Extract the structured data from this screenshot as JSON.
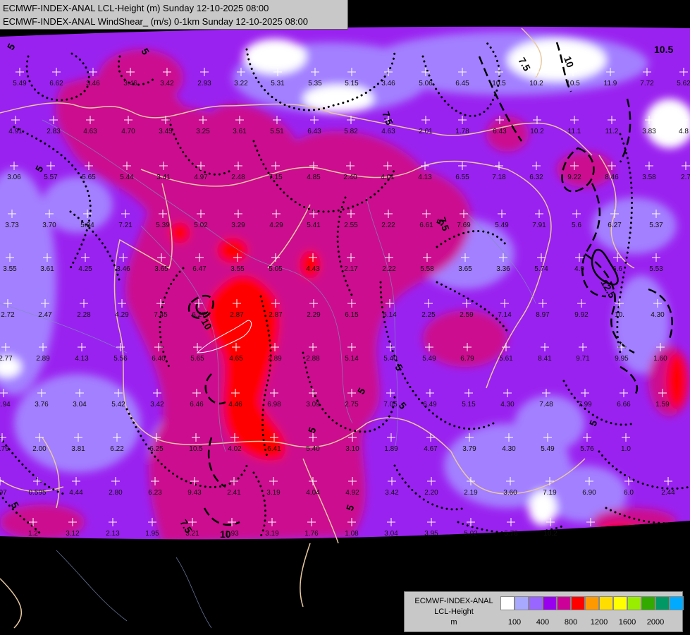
{
  "header": {
    "line1": "ECMWF-INDEX-ANAL LCL-Height (m) Sunday 12-10-2025 08:00",
    "line2": "ECMWF-INDEX-ANAL WindShear_ (m/s) 0-1km Sunday 12-10-2025 08:00"
  },
  "legend": {
    "title_line1": "ECMWF-INDEX-ANAL",
    "title_line2": "LCL-Height",
    "title_line3": "m",
    "colors": [
      "#ffffff",
      "#a8a8ff",
      "#9966ff",
      "#9900ee",
      "#cc0099",
      "#ff0000",
      "#ff9900",
      "#ffdd00",
      "#ffff00",
      "#99ee00",
      "#33aa00",
      "#009966",
      "#00aaff"
    ],
    "tick_labels": [
      "100",
      "400",
      "800",
      "1200",
      "1600",
      "2000"
    ]
  },
  "contour_labels": [
    "5",
    "5",
    "7.5",
    "10",
    "10.5",
    "12.5",
    "7.5",
    "5",
    "5",
    "7.5",
    "10",
    "5",
    "5",
    "5",
    "5",
    "7.5",
    "10",
    "5",
    "5",
    "5"
  ],
  "station_values": [
    "5.49",
    "6.62",
    "3.46",
    "3.46",
    "3.42",
    "2.93",
    "3.22",
    "5.31",
    "5.35",
    "5.15",
    "3.46",
    "5.06",
    "6.45",
    "10.5",
    "10.2",
    "10.5",
    "11.9",
    "7.72",
    "5.62",
    "4.91",
    "2.83",
    "4.63",
    "4.70",
    "3.45",
    "3.25",
    "3.61",
    "5.51",
    "6.43",
    "5.82",
    "4.63",
    "2.01",
    "1.78",
    "6.43",
    "10.2",
    "11.1",
    "11.2",
    "3.83",
    "4.8",
    "3.06",
    "5.57",
    "5.65",
    "5.44",
    "3.41",
    "4.97",
    "2.48",
    "7.15",
    "4.85",
    "2.40",
    "4.01",
    "4.13",
    "6.55",
    "7.18",
    "6.32",
    "9.22",
    "8.46",
    "3.58",
    "2.7",
    "3.73",
    "3.70",
    "5.94",
    "7.21",
    "5.39",
    "5.02",
    "3.29",
    "4.29",
    "5.41",
    "2.55",
    "2.22",
    "6.61",
    "7.69",
    "5.49",
    "7.91",
    "5.6",
    "6.27",
    "5.37",
    "3.55",
    "3.61",
    "4.25",
    "3.46",
    "3.65",
    "6.47",
    "3.55",
    "5.05",
    "4.43",
    "2.17",
    "2.22",
    "5.58",
    "3.65",
    "3.36",
    "5.74",
    "4.9",
    "6.6",
    "5.53",
    "2.72",
    "2.47",
    "2.28",
    "4.29",
    "7.45",
    "6.27",
    "2.87",
    "2.87",
    "2.29",
    "6.15",
    "5.14",
    "2.25",
    "2.59",
    "7.14",
    "8.97",
    "9.92",
    "10.",
    "4.30",
    "2.77",
    "2.89",
    "4.13",
    "5.56",
    "6.40",
    "5.65",
    "4.65",
    "2.89",
    "2.88",
    "5.14",
    "5.40",
    "5.49",
    "6.79",
    "5.61",
    "8.41",
    "9.71",
    "9.95",
    "1.60",
    "2.94",
    "3.76",
    "3.04",
    "5.42",
    "3.42",
    "6.46",
    "4.46",
    "6.98",
    "3.09",
    "2.75",
    "7.05",
    "6.49",
    "5.15",
    "4.30",
    "7.48",
    "7.99",
    "6.66",
    "1.59",
    "1.79",
    "2.00",
    "3.81",
    "6.22",
    "6.25",
    "10.5",
    "4.02",
    "6.41",
    "5.40",
    "3.10",
    "1.89",
    "4.67",
    "3.79",
    "4.30",
    "5.49",
    "5.76",
    "1.0",
    "5.97",
    "0.595",
    "4.44",
    "2.80",
    "6.23",
    "9.43",
    "2.41",
    "3.19",
    "4.04",
    "4.92",
    "3.42",
    "2.20",
    "2.19",
    "3.60",
    "7.19",
    "6.90",
    "6.0",
    "2.44",
    "1.2",
    "3.12",
    "2.13",
    "1.95",
    "3.21",
    "1.93",
    "3.19",
    "1.76",
    "1.08",
    "3.04",
    "3.95",
    "5.02",
    "5.78",
    "10.2"
  ]
}
